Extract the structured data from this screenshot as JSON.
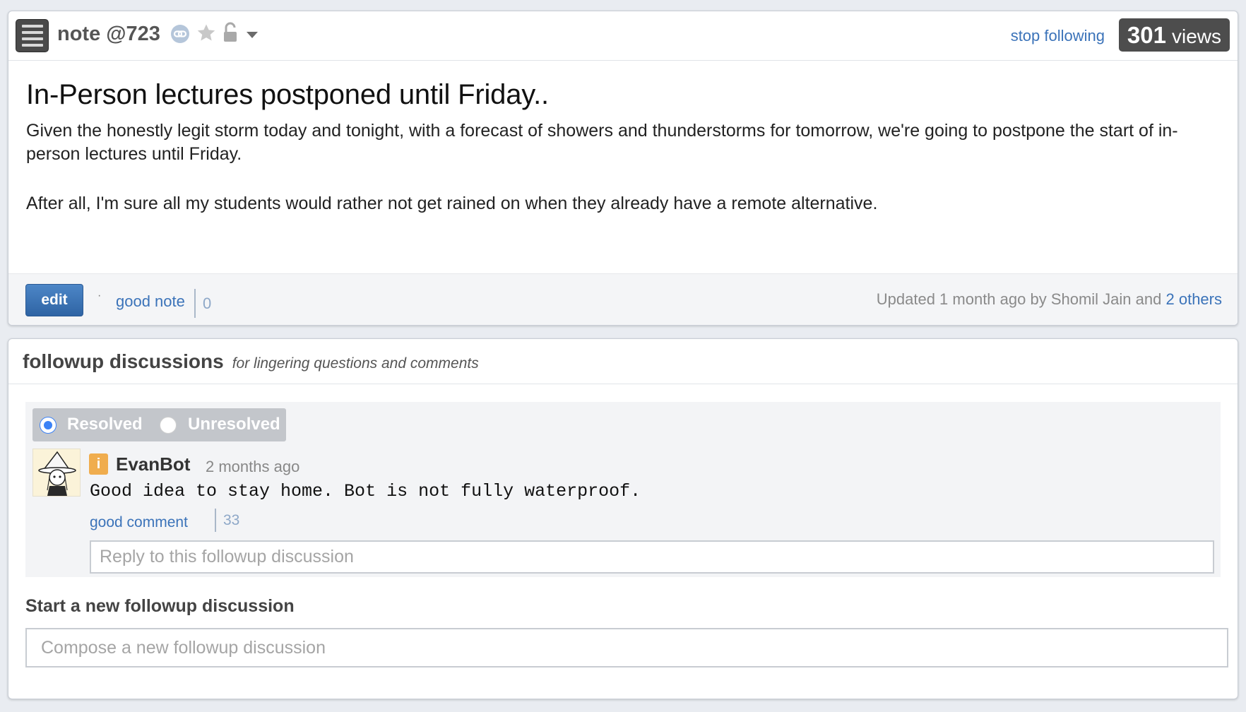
{
  "note": {
    "label": "note @723",
    "stop_following": "stop following",
    "views_count": "301",
    "views_label": "views",
    "title": "In-Person lectures postponed until Friday..",
    "paragraphs": [
      "Given the honestly legit storm today and tonight, with a forecast of showers and thunderstorms for tomorrow, we're going to postpone the start of in-person lectures until Friday.",
      "After all, I'm sure all my students would rather not get rained on when they already have a remote alternative."
    ],
    "edit_label": "edit",
    "dot": "·",
    "good_note_label": "good note",
    "good_note_count": "0",
    "updated_prefix": "Updated 1 month ago by Shomil Jain and",
    "updated_link": "2 others",
    "icons": [
      "menu-icon",
      "link-icon",
      "star-icon",
      "unlock-icon",
      "caret-down-icon"
    ]
  },
  "followup": {
    "title": "followup discussions",
    "subtitle": "for lingering questions and comments",
    "resolved_label": "Resolved",
    "unresolved_label": "Unresolved",
    "selected_state": "Resolved",
    "comment": {
      "badge": "i",
      "author": "EvanBot",
      "time": "2 months ago",
      "text": "Good idea to stay home. Bot is not fully waterproof.",
      "good_comment_label": "good comment",
      "good_comment_count": "33"
    },
    "reply_placeholder": "Reply to this followup discussion",
    "new_label": "Start a new followup discussion",
    "compose_placeholder": "Compose a new followup discussion"
  },
  "colors": {
    "link": "#3b73b9",
    "edit_button": "#3a72b5",
    "views_badge": "#4d4d4d",
    "instructor_badge": "#f0ad4e",
    "radio_selected": "#3b82f6"
  }
}
